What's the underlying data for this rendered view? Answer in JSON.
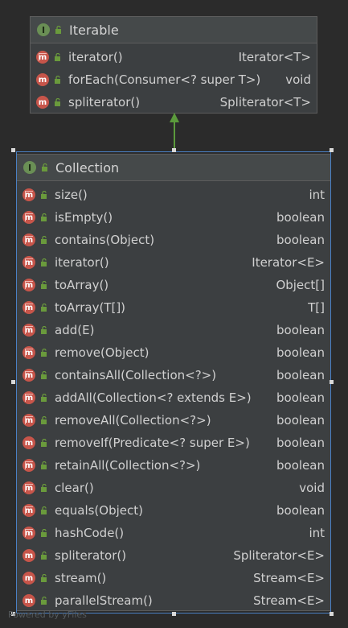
{
  "diagram": {
    "parent": {
      "title": "Iterable",
      "type_badge": "I",
      "methods": [
        {
          "name": "iterator()",
          "returns": "Iterator<T>",
          "abstract": true
        },
        {
          "name": "forEach(Consumer<? super T>)",
          "returns": "void",
          "abstract": false
        },
        {
          "name": "spliterator()",
          "returns": "Spliterator<T>",
          "abstract": false
        }
      ]
    },
    "child": {
      "title": "Collection",
      "type_badge": "I",
      "methods": [
        {
          "name": "size()",
          "returns": "int",
          "abstract": true
        },
        {
          "name": "isEmpty()",
          "returns": "boolean",
          "abstract": true
        },
        {
          "name": "contains(Object)",
          "returns": "boolean",
          "abstract": true
        },
        {
          "name": "iterator()",
          "returns": "Iterator<E>",
          "abstract": true
        },
        {
          "name": "toArray()",
          "returns": "Object[]",
          "abstract": true
        },
        {
          "name": "toArray(T[])",
          "returns": "T[]",
          "abstract": true
        },
        {
          "name": "add(E)",
          "returns": "boolean",
          "abstract": true
        },
        {
          "name": "remove(Object)",
          "returns": "boolean",
          "abstract": true
        },
        {
          "name": "containsAll(Collection<?>)",
          "returns": "boolean",
          "abstract": true
        },
        {
          "name": "addAll(Collection<? extends E>)",
          "returns": "boolean",
          "abstract": true
        },
        {
          "name": "removeAll(Collection<?>)",
          "returns": "boolean",
          "abstract": true
        },
        {
          "name": "removeIf(Predicate<? super E>)",
          "returns": "boolean",
          "abstract": false
        },
        {
          "name": "retainAll(Collection<?>)",
          "returns": "boolean",
          "abstract": true
        },
        {
          "name": "clear()",
          "returns": "void",
          "abstract": true
        },
        {
          "name": "equals(Object)",
          "returns": "boolean",
          "abstract": true
        },
        {
          "name": "hashCode()",
          "returns": "int",
          "abstract": true
        },
        {
          "name": "spliterator()",
          "returns": "Spliterator<E>",
          "abstract": false
        },
        {
          "name": "stream()",
          "returns": "Stream<E>",
          "abstract": false
        },
        {
          "name": "parallelStream()",
          "returns": "Stream<E>",
          "abstract": false
        }
      ]
    },
    "relation": "extends",
    "method_badge": "m",
    "watermark": "Powered by yFiles",
    "colors": {
      "interface_badge": "#6a8f55",
      "method_badge": "#c7554a",
      "public_lock": "#6a9a3c",
      "inheritance_arrow": "#5b9a3c",
      "selection": "#4a80c4"
    }
  }
}
